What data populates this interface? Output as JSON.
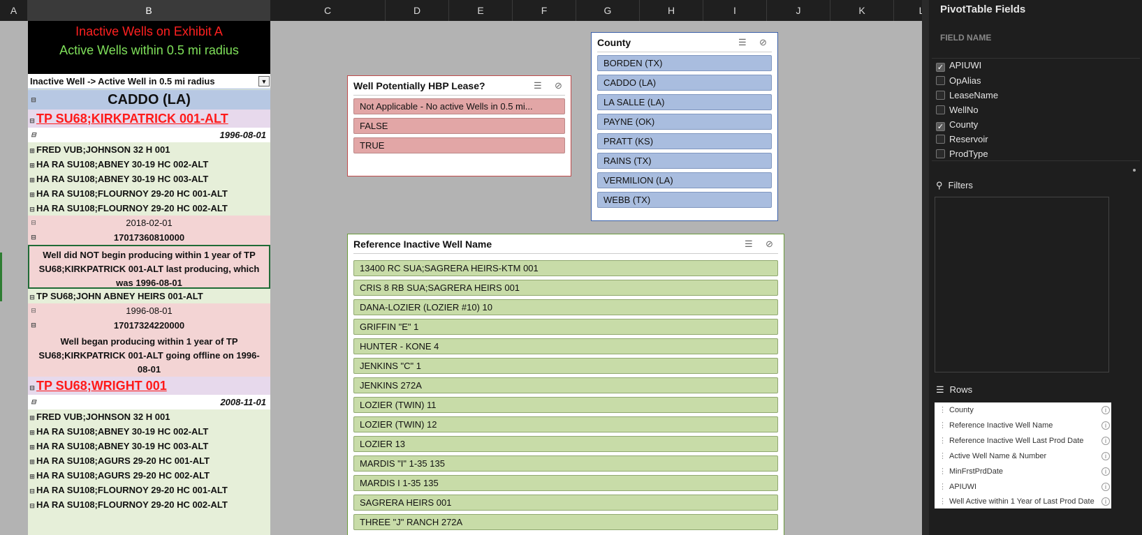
{
  "columns": [
    "A",
    "B",
    "C",
    "D",
    "E",
    "F",
    "G",
    "H",
    "I",
    "J",
    "K",
    "L"
  ],
  "title": {
    "line1": "Inactive Wells on Exhibit A",
    "line2": "Active Wells within 0.5 mi radius"
  },
  "pivot_filter_label": "Inactive Well -> Active Well in 0.5 mi radius",
  "rows": {
    "county": "CADDO (LA)",
    "inactive1": "TP SU68;KIRKPATRICK 001-ALT",
    "date1": "1996-08-01",
    "active": [
      "FRED VUB;JOHNSON 32 H 001",
      "HA RA SU108;ABNEY 30-19 HC 002-ALT",
      "HA RA SU108;ABNEY 30-19 HC 003-ALT",
      "HA RA SU108;FLOURNOY 29-20 HC 001-ALT",
      "HA RA SU108;FLOURNOY 29-20 HC 002-ALT"
    ],
    "date2": "2018-02-01",
    "api1": "17017360810000",
    "note1": "Well did NOT begin producing within 1 year of TP SU68;KIRKPATRICK 001-ALT last producing, which was 1996-08-01",
    "active_b": "TP SU68;JOHN ABNEY HEIRS 001-ALT",
    "date3": "1996-08-01",
    "api2": "17017324220000",
    "note2": "Well began producing within 1 year of TP SU68;KIRKPATRICK 001-ALT going offline on 1996-08-01",
    "inactive2": "TP SU68;WRIGHT 001",
    "date4": "2008-11-01",
    "active2": [
      "FRED VUB;JOHNSON 32 H 001",
      "HA RA SU108;ABNEY 30-19 HC 002-ALT",
      "HA RA SU108;ABNEY 30-19 HC 003-ALT",
      "HA RA SU108;AGURS 29-20 HC 001-ALT",
      "HA RA SU108;AGURS 29-20 HC 002-ALT",
      "HA RA SU108;FLOURNOY 29-20 HC 001-ALT",
      "HA RA SU108;FLOURNOY 29-20 HC 002-ALT"
    ]
  },
  "slicer_hbp": {
    "title": "Well Potentially HBP Lease?",
    "items": [
      "Not Applicable  - No active Wells  in 0.5 mi...",
      "FALSE",
      "TRUE"
    ]
  },
  "slicer_county": {
    "title": "County",
    "items": [
      "BORDEN  (TX)",
      "CADDO  (LA)",
      "LA SALLE  (LA)",
      "PAYNE  (OK)",
      "PRATT  (KS)",
      "RAINS  (TX)",
      "VERMILION  (LA)",
      "WEBB  (TX)"
    ]
  },
  "slicer_ref": {
    "title": "Reference Inactive Well Name",
    "items": [
      "13400 RC SUA;SAGRERA  HEIRS-KTM  001",
      "CRIS 8 RB SUA;SAGRERA  HEIRS 001",
      "DANA-LOZIER (LOZIER #10) 10",
      "GRIFFIN  \"E\"  1",
      "HUNTER - KONE 4",
      "JENKINS  \"C\"  1",
      "JENKINS 272A",
      "LOZIER  (TWIN) 11",
      "LOZIER  (TWIN) 12",
      "LOZIER 13",
      "MARDIS \"I\"  1-35 135",
      "MARDIS I  1-35 135",
      "SAGRERA  HEIRS 001",
      "THREE  \"J\"  RANCH 272A"
    ]
  },
  "pane": {
    "title": "PivotTable Fields",
    "field_name_label": "FIELD NAME",
    "fields": [
      {
        "name": "APIUWI",
        "checked": true
      },
      {
        "name": "OpAlias",
        "checked": false
      },
      {
        "name": "LeaseName",
        "checked": false
      },
      {
        "name": "WellNo",
        "checked": false
      },
      {
        "name": "County",
        "checked": true
      },
      {
        "name": "Reservoir",
        "checked": false
      },
      {
        "name": "ProdType",
        "checked": false
      }
    ],
    "filters_label": "Filters",
    "rows_label": "Rows",
    "row_fields": [
      "County",
      "Reference Inactive Well Name",
      "Reference Inactive Well Last Prod Date",
      "Active Well Name & Number",
      "MinFrstPrdDate",
      "APIUWI",
      "Well Active within 1 Year of Last Prod Date"
    ]
  }
}
